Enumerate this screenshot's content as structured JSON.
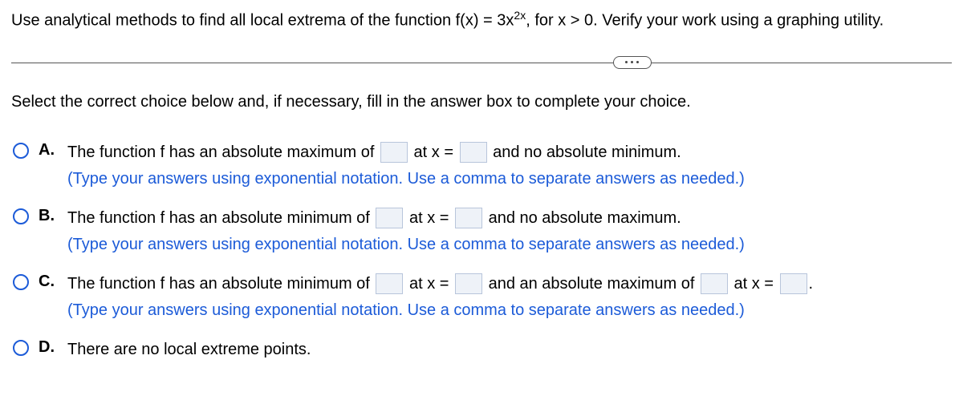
{
  "question": {
    "prefix": "Use analytical methods to find all local extrema of the function f(x) = 3x",
    "exponent": "2x",
    "suffix": ", for x > 0. Verify your work using a graphing utility."
  },
  "instruction": "Select the correct choice below and, if necessary, fill in the answer box to complete your choice.",
  "choices": {
    "A": {
      "label": "A.",
      "part1": "The function f has an absolute maximum of ",
      "part2": " at x = ",
      "part3": " and no absolute minimum.",
      "hint": "(Type your answers using exponential notation. Use a comma to separate answers as needed.)"
    },
    "B": {
      "label": "B.",
      "part1": "The function f has an absolute minimum of ",
      "part2": " at x = ",
      "part3": " and no absolute maximum.",
      "hint": "(Type your answers using exponential notation. Use a comma to separate answers as needed.)"
    },
    "C": {
      "label": "C.",
      "part1": "The function f has an absolute minimum of ",
      "part2": " at x = ",
      "part3": " and an absolute maximum of ",
      "part4": " at x = ",
      "part5": ".",
      "hint": "(Type your answers using exponential notation. Use a comma to separate answers as needed.)"
    },
    "D": {
      "label": "D.",
      "text": "There are no local extreme points."
    }
  }
}
